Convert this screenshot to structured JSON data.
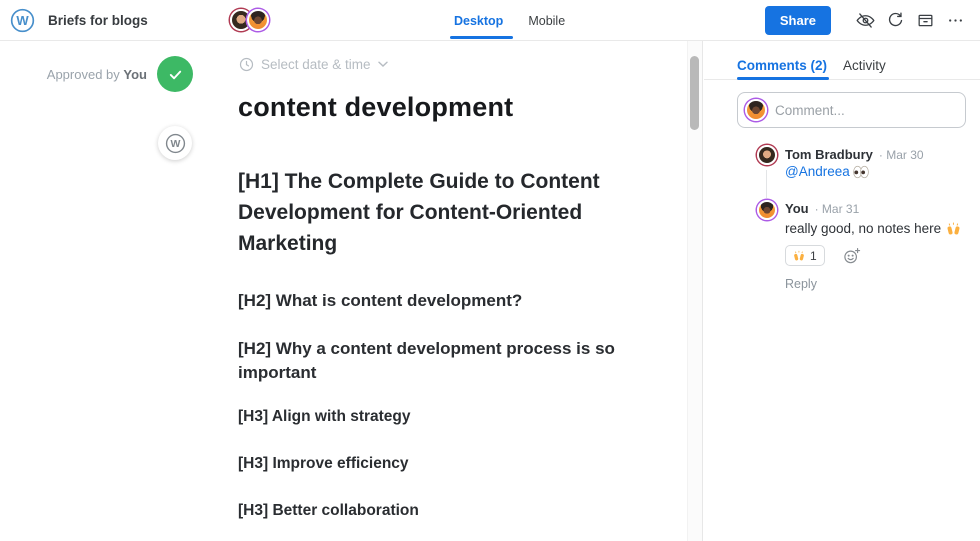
{
  "colors": {
    "accent_blue": "#1673e1",
    "approve_green": "#3db965",
    "tom_ring": "#b03a52",
    "andreea_ring": "#ac5be6",
    "emoji_orange": "#fbb040"
  },
  "topbar": {
    "app_title": "Briefs for blogs",
    "logo_icon": "wordpress-logo",
    "view_tabs": [
      {
        "label": "Desktop",
        "active": true
      },
      {
        "label": "Mobile",
        "active": false
      }
    ],
    "share_label": "Share",
    "action_icons": [
      "hide-preview-icon",
      "refresh-icon",
      "archive-icon",
      "more-icon"
    ]
  },
  "approval": {
    "prefix": "Approved by",
    "approver": "You",
    "badge_icon": "check-icon"
  },
  "document": {
    "date_picker_label": "Select date & time",
    "title": "content development",
    "h1": "[H1] The Complete Guide to Content Development for Content-Oriented Marketing",
    "h2_1": "[H2] What is content development?",
    "h2_2": "[H2] Why a content development process is so important",
    "h3_1": "[H3] Align with strategy",
    "h3_2": "[H3] Improve efficiency",
    "h3_3": "[H3] Better collaboration"
  },
  "sidebar": {
    "tabs": [
      {
        "label": "Comments (2)",
        "active": true
      },
      {
        "label": "Activity",
        "active": false
      }
    ],
    "composer_placeholder": "Comment...",
    "comments": [
      {
        "author": "Tom Bradbury",
        "date_meta": "· Mar 30",
        "body": "@Andreea",
        "body_emoji": "👀"
      },
      {
        "author": "You",
        "date_meta": "· Mar 31",
        "body": "really good, no notes here",
        "body_emoji": "🙌",
        "reaction": {
          "emoji": "🙌",
          "count": "1"
        },
        "reply_label": "Reply"
      }
    ]
  }
}
